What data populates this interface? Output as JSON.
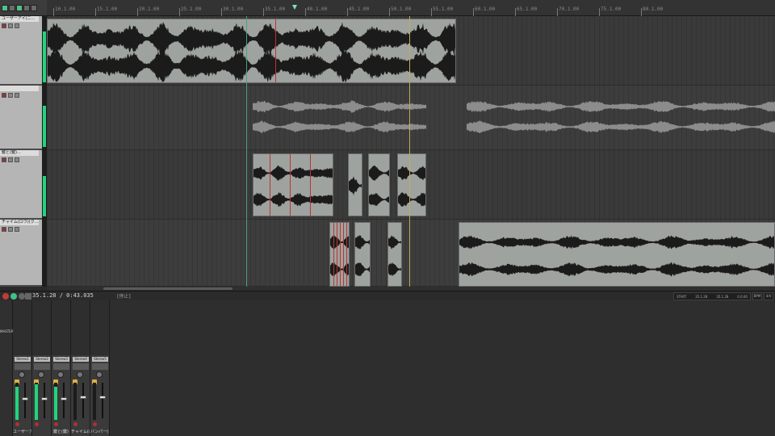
{
  "ruler": {
    "labels": [
      "10.1.00",
      "15.1.00",
      "20.1.00",
      "25.1.00",
      "30.1.00",
      "35.1.00",
      "40.1.00",
      "45.1.00",
      "50.1.00",
      "55.1.00",
      "60.1.00",
      "65.1.00",
      "70.1.00",
      "75.1.00",
      "80.1.00"
    ]
  },
  "tracks": [
    {
      "name": "ユーザーアイ(ニ…",
      "meter": 0.95
    },
    {
      "name": "",
      "meter": 0.85
    },
    {
      "name": "鍵と(鍵)…",
      "meter": 0.75
    },
    {
      "name": "チャイム(ロウ)(ク…",
      "meter": 0.0
    }
  ],
  "transport": {
    "time": "35.1.28 / 0:43.035",
    "state": "[停止]",
    "selection": [
      "START",
      "35.1.28",
      "35.1.28",
      "0.0.00"
    ],
    "bpm": "BPM",
    "rate": "4/4"
  },
  "mixer": {
    "master_label": "MASTER",
    "strips": [
      {
        "label": "ユーザーアイ(ニ",
        "fx": "Stereo1",
        "meter": 0.9,
        "fader": 0.55
      },
      {
        "label": "",
        "fx": "Stereo2",
        "meter": 0.95,
        "fader": 0.55
      },
      {
        "label": "鍵と(鍵)",
        "fx": "Stereo3",
        "meter": 0.9,
        "fader": 0.55
      },
      {
        "label": "チャイム(ロウ)",
        "fx": "Stereo4",
        "meter": 0.0,
        "fader": 0.6
      },
      {
        "label": "バンパー(ダール",
        "fx": "Stereo5",
        "meter": 0.0,
        "fader": 0.6
      }
    ]
  },
  "colors": {
    "meter": "#22d47c",
    "item": "#9ea39f",
    "waveform": "#1b1b1b",
    "playhead": "#c9a85a"
  }
}
